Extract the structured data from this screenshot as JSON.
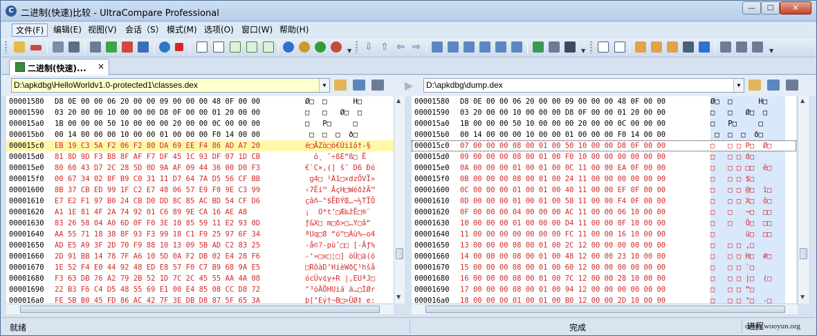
{
  "window": {
    "title": "二进制(快速)比较 - UltraCompare Professional",
    "app_icon": "C"
  },
  "window_buttons": {
    "minimize": "—",
    "maximize": "☐",
    "close": "✕"
  },
  "menu": [
    "文件(F)",
    "编辑(E)",
    "视图(V)",
    "会话（S）",
    "模式(M)",
    "选项(O)",
    "窗口(W)",
    "帮助(H)"
  ],
  "tab": {
    "label": "二进制(快速)...",
    "close": "×"
  },
  "left": {
    "path": "D:\\apkdbg\\HelloWorldv1.0-protected1\\classes.dex",
    "rows": [
      {
        "off": "00001580",
        "hex": "D8 0E 00 00 06 20 00 00 09 00 00 00 48 0F 00 00",
        "asc": "Ø□  □      H□",
        "diff": false
      },
      {
        "off": "00001590",
        "hex": "03 20 00 00 10 00 00 00 D8 0F 00 00 01 20 00 00",
        "asc": "□   □   Ø□  □",
        "diff": false
      },
      {
        "off": "000015a0",
        "hex": "1B 00 00 00 50 10 00 00 00 20 00 00 0C 00 00 00",
        "asc": "□   P□     □",
        "diff": false
      },
      {
        "off": "000015b0",
        "hex": "00 14 00 00 00 10 00 00 01 00 00 00 F0 14 00 00",
        "asc": " □  □  □  ð□",
        "diff": false
      },
      {
        "off": "000015c0",
        "hex": "EB 19 C3 5A F2 06 F2 80 DA 69 EE F4 86 AD A7 20",
        "asc": "ë□ÃZò□ò€Úiîô†-§",
        "diff": true
      },
      {
        "off": "000015d0",
        "hex": "81 8D 9D F3 B8 8F AF F7 DF 45 1C 93 DF 07 1D CB",
        "asc": "  ó¸ ¯÷ßE“ß□ Ë",
        "diff": true
      },
      {
        "off": "000015e0",
        "hex": "80 60 43 D7 2C 28 5D 0D 9A AF 09 44 36 00 D0 F3",
        "asc": "€`C×,(] š¯ D6 Ðó",
        "diff": true
      },
      {
        "off": "000015f0",
        "hex": "00 67 34 02 8F B9 C0 31 11 D7 64 7A D5 56 CF BB",
        "asc": " g4□ ¹À1□×dzÕVÏ»",
        "diff": true
      },
      {
        "off": "00001600",
        "hex": "8B 37 CB ED 99 1F C2 E7 48 06 57 E9 F0 9E C3 99",
        "asc": "‹7Ëí™ ÂçH□WéðžÃ™",
        "diff": true
      },
      {
        "off": "00001610",
        "hex": "E7 E2 F1 97 B0 24 CB D0 DD 8C 85 AC BD 54 CF D6",
        "asc": "çâñ—°$ËÐÝŒ…¬½TÏÖ",
        "diff": true
      },
      {
        "off": "00001620",
        "hex": "A1 1E 81 4F 2A 74 92 01 C6 89 9E CA 16 AE A8",
        "asc": "¡  O*t’□Æ‰žÊ□®¨",
        "diff": true
      },
      {
        "off": "00001630",
        "hex": "83 26 58 04 A0 6D 0F F0 3E 10 85 59 11 E2 93 0D",
        "asc": "ƒ&X□ m□ð>□…Y□â“",
        "diff": true
      },
      {
        "off": "00001640",
        "hex": "AA 55 71 18 38 8F 93 F3 99 18 C1 F9 25 97 6F 34",
        "asc": "ªUq□8 “ó™□Áù%—o4",
        "diff": true
      },
      {
        "off": "00001650",
        "hex": "AD E5 A9 3F 2D 70 F9 88 10 13 09 5B AD C2 83 25",
        "asc": "-å©?-pùˆ□□ [-Âƒ%",
        "diff": true
      },
      {
        "off": "00001660",
        "hex": "2D 91 BB 14 78 7F A6 10 5D 0A F2 DB 02 E4 28 F6",
        "asc": "-‘»□x□¦□] òÛ□ä(ö",
        "diff": true
      },
      {
        "off": "00001670",
        "hex": "1E 52 F4 E0 44 92 48 ED E8 57 F0 C7 B9 68 9A E5",
        "asc": "□RôàD’HíèWðÇ¹hšå",
        "diff": true
      },
      {
        "off": "00001680",
        "hex": "F3 63 DB 76 A2 79 2B 52 1D 7C 2C 45 55 AA 4A 08",
        "asc": "ócÛv¢y+R |,EUªJ□",
        "diff": true
      },
      {
        "off": "00001690",
        "hex": "22 B3 F6 C4 D5 48 55 69 E1 00 E4 85 08 CC D8 72",
        "asc": "\"³öÄÕHUiá ä…□ÌØr",
        "diff": true
      },
      {
        "off": "000016a0",
        "hex": "FE 5B B0 45 FD 86 AC 42 7F 3E DB D8 87 5F 65 3A",
        "asc": "þ[°Eý†¬B□>ÛØ‡_e:",
        "diff": true
      }
    ]
  },
  "right": {
    "path": "D:\\apkdbg\\dump.dex",
    "rows": [
      {
        "off": "00001580",
        "hex": "D8 0E 00 00 06 20 00 00 09 00 00 00 48 0F 00 00",
        "asc": "Ø□  □      H□",
        "diff": false
      },
      {
        "off": "00001590",
        "hex": "03 20 00 00 10 00 00 00 D8 0F 00 00 01 20 00 00",
        "asc": "□   □   Ø□  □",
        "diff": false
      },
      {
        "off": "000015a0",
        "hex": "1B 00 00 00 50 10 00 00 00 20 00 00 0C 00 00 00",
        "asc": "□   P□     □",
        "diff": false
      },
      {
        "off": "000015b0",
        "hex": "00 14 00 00 00 10 00 00 01 00 00 00 F0 14 00 00",
        "asc": " □  □  □  ð□",
        "diff": false
      },
      {
        "off": "000015c0",
        "hex": "07 00 00 00 08 00 01 00 50 10 00 00 D8 0F 00 00",
        "asc": "□   □ □ P□  Ø□",
        "diff": true
      },
      {
        "off": "000015d0",
        "hex": "09 00 00 00 08 00 01 00 F0 10 00 00 00 00 00 00",
        "asc": "□   □ □ ð□",
        "diff": true
      },
      {
        "off": "000015e0",
        "hex": "0A 00 00 00 01 00 01 00 0C 11 00 00 EA 0F 00 00",
        "asc": "□   □ □ □□  ê□",
        "diff": true
      },
      {
        "off": "000015f0",
        "hex": "0B 00 00 00 08 00 01 00 24 11 00 00 00 00 00 00",
        "asc": "□   □ □ $□",
        "diff": true
      },
      {
        "off": "00001600",
        "hex": "0C 00 00 00 01 00 01 00 40 11 00 00 EF 0F 00 00",
        "asc": "□   □ □ @□  ï□",
        "diff": true
      },
      {
        "off": "00001610",
        "hex": "0D 00 00 00 01 00 01 00 58 11 00 00 F4 0F 00 00",
        "asc": "□   □ □ X□  ô□",
        "diff": true
      },
      {
        "off": "00001620",
        "hex": "0F 00 00 00 04 00 00 00 AC 11 00 00 06 10 00 00",
        "asc": "□   □   ¬□  □□",
        "diff": true
      },
      {
        "off": "00001630",
        "hex": "10 00 00 00 01 00 00 00 D4 11 00 00 0F 10 00 00",
        "asc": "□   □   Ô□  □□",
        "diff": true
      },
      {
        "off": "00001640",
        "hex": "11 00 00 00 00 00 00 00 FC 11 00 00 16 10 00 00",
        "asc": "□       ü□  □□",
        "diff": true
      },
      {
        "off": "00001650",
        "hex": "13 00 00 00 08 00 01 00 2C 12 00 00 00 00 00 00",
        "asc": "□   □ □ ,□",
        "diff": true
      },
      {
        "off": "00001660",
        "hex": "14 00 00 00 08 00 01 00 48 12 00 00 23 10 00 00",
        "asc": "□   □ □ H□  #□",
        "diff": true
      },
      {
        "off": "00001670",
        "hex": "15 00 00 00 08 00 01 00 60 12 00 00 00 00 00 00",
        "asc": "□   □ □ `□",
        "diff": true
      },
      {
        "off": "00001680",
        "hex": "16 00 00 00 08 00 01 00 7C 12 00 00 28 10 00 00",
        "asc": "□   □ □ |□  (□",
        "diff": true
      },
      {
        "off": "00001690",
        "hex": "17 00 00 00 08 00 01 00 94 12 00 00 00 00 00 00",
        "asc": "□   □ □ ”□",
        "diff": true
      },
      {
        "off": "000016a0",
        "hex": "18 00 00 00 01 00 01 00 B0 12 00 00 2D 10 00 00",
        "asc": "□   □ □ °□  -□",
        "diff": true
      }
    ]
  },
  "status": {
    "left": "就绪",
    "middle": "完成",
    "right": "进程"
  },
  "watermark": "drops.wooyun.org",
  "colors": {
    "diff_text": "#d42a2a",
    "highlight_left": "#fff8a8",
    "diff_bg_right": "#d9e8fb"
  }
}
